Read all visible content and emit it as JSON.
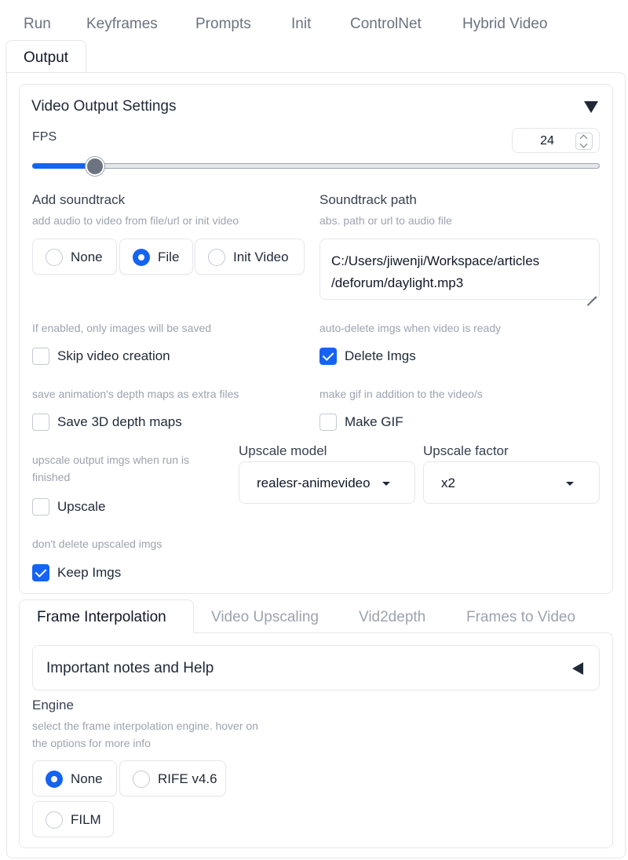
{
  "tabs": [
    "Run",
    "Keyframes",
    "Prompts",
    "Init",
    "ControlNet",
    "Hybrid Video",
    "Output"
  ],
  "active_tab": "Output",
  "video_output": {
    "title": "Video Output Settings",
    "fps": {
      "label": "FPS",
      "value": "24",
      "slider_fraction": 0.11
    },
    "soundtrack": {
      "label": "Add soundtrack",
      "info": "add audio to video from file/url or init video",
      "options": [
        "None",
        "File",
        "Init Video"
      ],
      "selected": "File"
    },
    "soundtrack_path": {
      "label": "Soundtrack path",
      "info": "abs. path or url to audio file",
      "value_line1": "C:/Users/jiwenji/Workspace/articles",
      "value_line2": "/deforum/daylight.mp3"
    },
    "skip_video": {
      "info": "If enabled, only images will be saved",
      "label": "Skip video creation",
      "checked": false
    },
    "delete_imgs": {
      "info": "auto-delete imgs when video is ready",
      "label": "Delete Imgs",
      "checked": true
    },
    "save_depth": {
      "info": "save animation's depth maps as extra files",
      "label": "Save 3D depth maps",
      "checked": false
    },
    "make_gif": {
      "info": "make gif in addition to the video/s",
      "label": "Make GIF",
      "checked": false
    },
    "upscale": {
      "info_line1": "upscale output imgs when run is",
      "info_line2": "finished",
      "label": "Upscale",
      "checked": false
    },
    "upscale_model": {
      "label": "Upscale model",
      "value": "realesr-animevideo"
    },
    "upscale_factor": {
      "label": "Upscale factor",
      "value": "x2"
    },
    "keep_imgs": {
      "info": "don't delete upscaled imgs",
      "label": "Keep Imgs",
      "checked": true
    }
  },
  "sub_tabs": [
    "Frame Interpolation",
    "Video Upscaling",
    "Vid2depth",
    "Frames to Video"
  ],
  "active_sub_tab": "Frame Interpolation",
  "frame_interp": {
    "help_title": "Important notes and Help",
    "engine": {
      "label": "Engine",
      "info_line1": "select the frame interpolation engine. hover on",
      "info_line2": "the options for more info",
      "options": [
        "None",
        "RIFE v4.6",
        "FILM"
      ],
      "selected": "None"
    }
  },
  "colors": {
    "accent": "#1463f3",
    "border": "#e5e7eb",
    "muted": "#9ca3af"
  }
}
